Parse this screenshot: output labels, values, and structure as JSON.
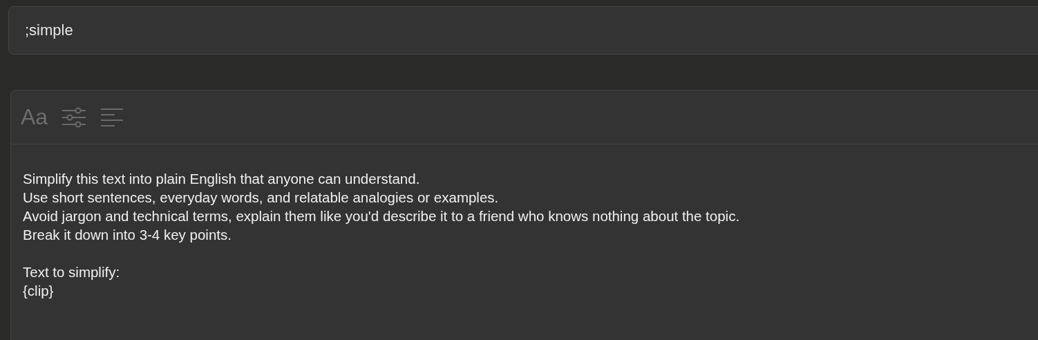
{
  "trigger_field": {
    "value": ";simple"
  },
  "editor": {
    "toolbar": {
      "font_button": "Aa"
    },
    "paragraphs": [
      [
        "Simplify this text into plain English that anyone can understand.",
        "Use short sentences, everyday words, and relatable analogies or examples.",
        "Avoid jargon and technical terms, explain them like you'd describe it to a friend who knows nothing about the topic.",
        "Break it down into 3-4 key points."
      ],
      [
        "Text to simplify:",
        "{clip}"
      ]
    ]
  }
}
